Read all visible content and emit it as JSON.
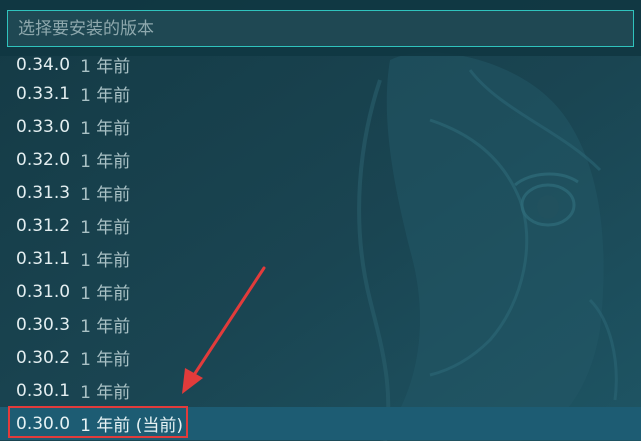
{
  "search": {
    "placeholder": "选择要安装的版本"
  },
  "versions": [
    {
      "version": "0.34.0",
      "age": "1 年前"
    },
    {
      "version": "0.33.1",
      "age": "1 年前"
    },
    {
      "version": "0.33.0",
      "age": "1 年前"
    },
    {
      "version": "0.32.0",
      "age": "1 年前"
    },
    {
      "version": "0.31.3",
      "age": "1 年前"
    },
    {
      "version": "0.31.2",
      "age": "1 年前"
    },
    {
      "version": "0.31.1",
      "age": "1 年前"
    },
    {
      "version": "0.31.0",
      "age": "1 年前"
    },
    {
      "version": "0.30.3",
      "age": "1 年前"
    },
    {
      "version": "0.30.2",
      "age": "1 年前"
    },
    {
      "version": "0.30.1",
      "age": "1 年前"
    },
    {
      "version": "0.30.0",
      "age": "1 年前 (当前)"
    }
  ],
  "colors": {
    "accent_border": "#2fc3bd",
    "selected_row": "#1d5c73",
    "annotation_red": "#e23b3b",
    "background": "#173f4b"
  }
}
